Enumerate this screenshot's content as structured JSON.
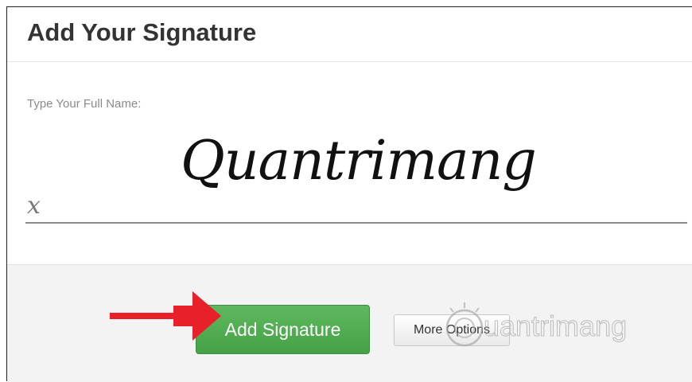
{
  "header": {
    "title": "Add Your Signature"
  },
  "form": {
    "name_label": "Type Your Full Name:",
    "signature_prefix": "x",
    "signature_value": "Quantrimang"
  },
  "footer": {
    "add_signature_label": "Add Signature",
    "more_options_label": "More Options"
  },
  "annotation": {
    "arrow_color": "#e8202a",
    "watermark": "uantrimang"
  },
  "colors": {
    "primary_button": "#4caf50",
    "footer_bg": "#f3f3f3"
  }
}
